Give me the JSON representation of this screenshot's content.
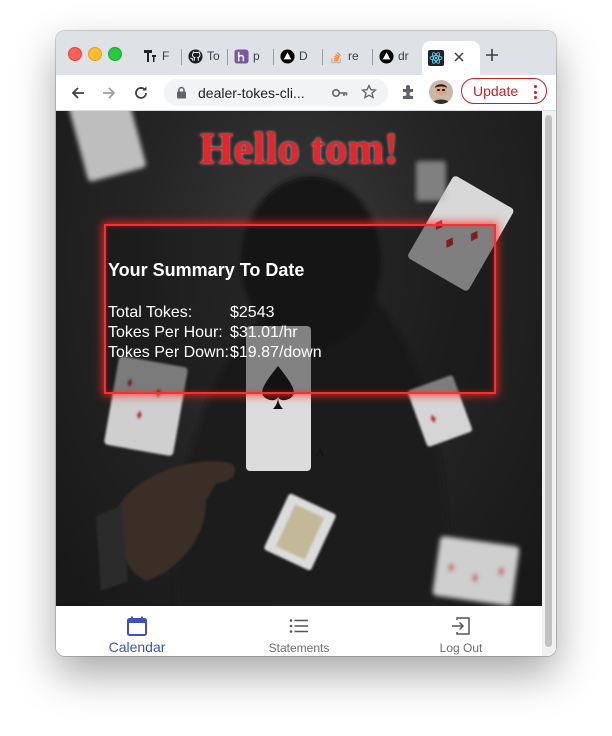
{
  "browser": {
    "tabs": [
      {
        "label": "F"
      },
      {
        "label": "To"
      },
      {
        "label": "p"
      },
      {
        "label": "D"
      },
      {
        "label": "re"
      },
      {
        "label": "dr"
      },
      {
        "label": "",
        "active": true
      }
    ],
    "url": "dealer-tokes-cli...",
    "update_label": "Update"
  },
  "page": {
    "greeting": "Hello tom!",
    "summary": {
      "title": "Your Summary To Date",
      "stats": [
        {
          "label": "Total Tokes:",
          "value": "$2543"
        },
        {
          "label": "Tokes Per Hour:",
          "value": "$31.01/hr"
        },
        {
          "label": "Tokes Per Down:",
          "value": "$19.87/down"
        }
      ]
    }
  },
  "bottom_nav": {
    "items": [
      {
        "label": "Calendar",
        "icon": "calendar-icon",
        "active": true
      },
      {
        "label": "Statements",
        "icon": "list-icon"
      },
      {
        "label": "Log Out",
        "icon": "logout-icon"
      }
    ]
  },
  "colors": {
    "greeting": "#e8232a",
    "summary_border": "#ff2d2d",
    "nav_active": "#3f51b5",
    "update_red": "#c5221f"
  }
}
